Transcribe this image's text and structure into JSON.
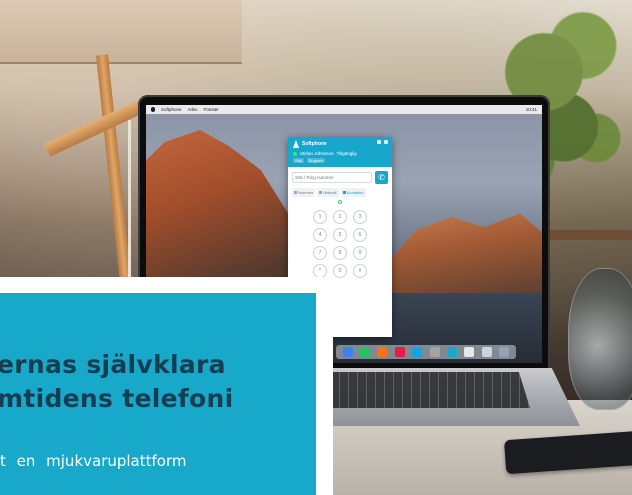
{
  "promo": {
    "headline_line1": "ernas självklara",
    "headline_line2": "mtidens telefoni",
    "body_text": "t en mjukvaruplattform"
  },
  "softphone": {
    "app_title": "Softphone",
    "user_name": "Stefan Johnsson",
    "status": "Tillgänglig",
    "queues": [
      "Sälj",
      "Support"
    ],
    "dial_placeholder": "Sök / Ring nummer",
    "tabs": [
      "Nummer",
      "Historik",
      "Kontakter"
    ],
    "keypad": [
      "1",
      "2",
      "3",
      "4",
      "5",
      "6",
      "7",
      "8",
      "9",
      "*",
      "0",
      "#"
    ]
  },
  "macos": {
    "menubar_items": [
      "Softphone",
      "Arkiv",
      "Fönster"
    ],
    "clock": "10:41"
  },
  "colors": {
    "brand_teal": "#17a8ca",
    "headline_navy": "#173d52",
    "promo_border": "#ffffff"
  },
  "icons": [
    "call-icon",
    "apple-logo-icon",
    "status-dot-icon"
  ]
}
